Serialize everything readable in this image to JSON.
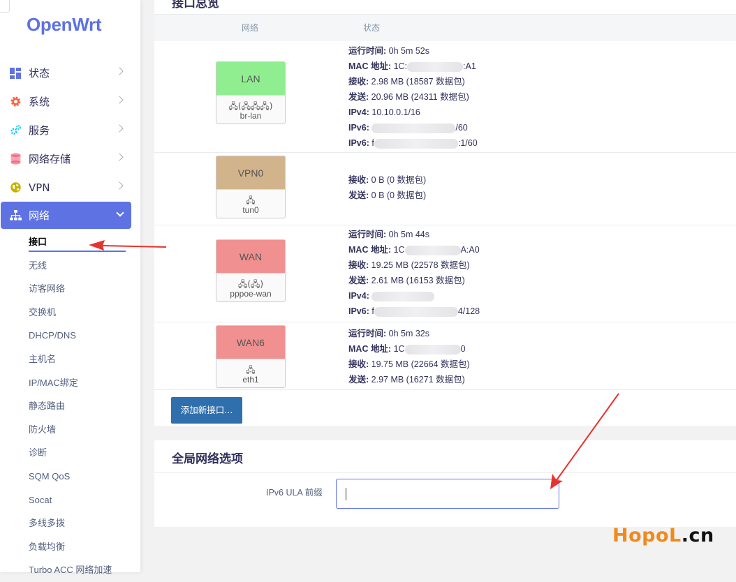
{
  "app": {
    "logo": "OpenWrt"
  },
  "sidebar": {
    "items": [
      {
        "label": "状态",
        "icon": "dashboard-icon",
        "color": "#5e72e4"
      },
      {
        "label": "系统",
        "icon": "gear-icon",
        "color": "#fb6340"
      },
      {
        "label": "服务",
        "icon": "cogs-icon",
        "color": "#11cdef"
      },
      {
        "label": "网络存储",
        "icon": "database-icon",
        "color": "#f5365c"
      },
      {
        "label": "VPN",
        "icon": "globe-icon",
        "color": "#a6a600"
      },
      {
        "label": "网络",
        "icon": "sitemap-icon",
        "color": "#ffffff"
      }
    ],
    "sub_items": [
      "接口",
      "无线",
      "访客网络",
      "交换机",
      "DHCP/DNS",
      "主机名",
      "IP/MAC绑定",
      "静态路由",
      "防火墙",
      "诊断",
      "SQM QoS",
      "Socat",
      "多线多拨",
      "负载均衡",
      "Turbo ACC 网络加速"
    ]
  },
  "overview": {
    "title": "接口总览",
    "col_network": "网络",
    "col_status": "状态",
    "interfaces": [
      {
        "name": "LAN",
        "device": "br-lan",
        "icons": "🖧(🖧🖧🖧)",
        "color": "#90ee90",
        "lines": [
          {
            "label": "运行时间:",
            "value": " 0h 5m 52s"
          },
          {
            "label": "MAC 地址:",
            "value": " 1C:",
            "tail": ":A1"
          },
          {
            "label": "接收:",
            "value": " 2.98 MB (18587 数据包)"
          },
          {
            "label": "发送:",
            "value": " 20.96 MB (24311 数据包)"
          },
          {
            "label": "IPv4:",
            "value": " 10.10.0.1/16"
          },
          {
            "label": "IPv6:",
            "value": " ",
            "tail": "/60"
          },
          {
            "label": "IPv6:",
            "value": " f",
            "tail": ":1/60"
          }
        ]
      },
      {
        "name": "VPN0",
        "device": "tun0",
        "icons": "🖧",
        "color": "#d2b48c",
        "lines": [
          {
            "label": "接收:",
            "value": " 0 B (0 数据包)"
          },
          {
            "label": "发送:",
            "value": " 0 B (0 数据包)"
          }
        ]
      },
      {
        "name": "WAN",
        "device": "pppoe-wan",
        "icons": "🖧(🖧)",
        "color": "#f09090",
        "lines": [
          {
            "label": "运行时间:",
            "value": " 0h 5m 44s"
          },
          {
            "label": "MAC 地址:",
            "value": " 1C",
            "tail": "A:A0"
          },
          {
            "label": "接收:",
            "value": " 19.25 MB (22578 数据包)"
          },
          {
            "label": "发送:",
            "value": " 2.61 MB (16153 数据包)"
          },
          {
            "label": "IPv4:",
            "value": " "
          },
          {
            "label": "IPv6:",
            "value": " f",
            "tail": "4/128"
          }
        ]
      },
      {
        "name": "WAN6",
        "device": "eth1",
        "icons": "🖧",
        "color": "#f09090",
        "lines": [
          {
            "label": "运行时间:",
            "value": " 0h 5m 32s"
          },
          {
            "label": "MAC 地址:",
            "value": " 1C",
            "tail": "0"
          },
          {
            "label": "接收:",
            "value": " 19.75 MB (22664 数据包)"
          },
          {
            "label": "发送:",
            "value": " 2.97 MB (16271 数据包)"
          }
        ]
      }
    ],
    "add_button": "添加新接口..."
  },
  "global": {
    "title": "全局网络选项",
    "ula_label": "IPv6 ULA 前缀",
    "ula_value": ""
  },
  "watermark": {
    "part_a": "HopoL",
    "part_b": ".cn"
  }
}
